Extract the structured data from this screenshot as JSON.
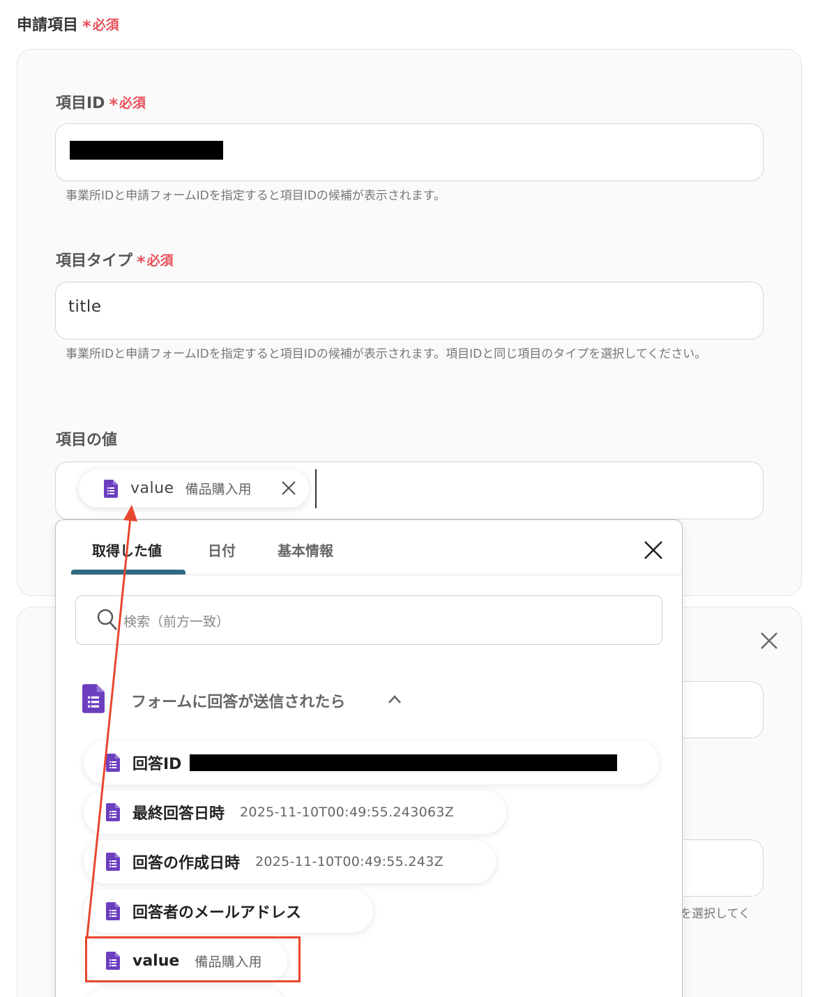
{
  "section": {
    "title": "申請項目",
    "required": "必須"
  },
  "fields": {
    "item_id": {
      "label": "項目ID",
      "required": "必須",
      "help": "事業所IDと申請フォームIDを指定すると項目IDの候補が表示されます。"
    },
    "item_type": {
      "label": "項目タイプ",
      "required": "必須",
      "value": "title",
      "help": "事業所IDと申請フォームIDを指定すると項目IDの候補が表示されます。項目IDと同じ項目のタイプを選択してください。"
    },
    "item_value": {
      "label": "項目の値",
      "chip_name": "value",
      "chip_sub": "備品購入用"
    }
  },
  "dropdown": {
    "tabs": [
      "取得した値",
      "日付",
      "基本情報"
    ],
    "search_placeholder": "検索（前方一致）",
    "group_title": "フォームに回答が送信されたら",
    "items": [
      {
        "label": "回答ID",
        "value": ""
      },
      {
        "label": "最終回答日時",
        "value": "2025-11-10T00:49:55.243063Z"
      },
      {
        "label": "回答の作成日時",
        "value": "2025-11-10T00:49:55.243Z"
      },
      {
        "label": "回答者のメールアドレス",
        "value": ""
      },
      {
        "label": "value",
        "value": "備品購入用"
      }
    ]
  },
  "background": {
    "partial_help": "を選択してく"
  },
  "colors": {
    "required": "#e8505b",
    "form_icon": "#6c3fbf",
    "tab_underline": "#2e6a80",
    "highlight": "#e8462e"
  }
}
